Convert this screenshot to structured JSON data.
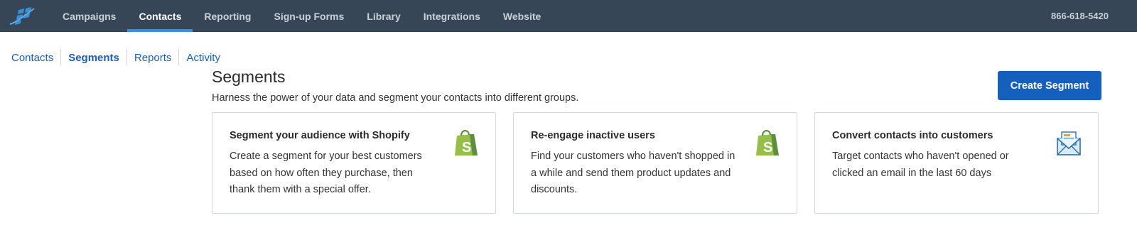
{
  "topnav": {
    "items": [
      {
        "label": "Campaigns",
        "active": false
      },
      {
        "label": "Contacts",
        "active": true
      },
      {
        "label": "Reporting",
        "active": false
      },
      {
        "label": "Sign-up Forms",
        "active": false
      },
      {
        "label": "Library",
        "active": false
      },
      {
        "label": "Integrations",
        "active": false
      },
      {
        "label": "Website",
        "active": false
      }
    ],
    "phone": "866-618-5420"
  },
  "subnav": {
    "items": [
      {
        "label": "Contacts",
        "active": false
      },
      {
        "label": "Segments",
        "active": true
      },
      {
        "label": "Reports",
        "active": false
      },
      {
        "label": "Activity",
        "active": false
      }
    ]
  },
  "page": {
    "title": "Segments",
    "subtitle": "Harness the power of your data and segment your contacts into different groups.",
    "create_button": "Create Segment"
  },
  "cards": [
    {
      "title": "Segment your audience with Shopify",
      "description": "Create a segment for your best customers based on how often they purchase, then thank them with a special offer.",
      "icon": "shopify-bag-icon"
    },
    {
      "title": "Re-engage inactive users",
      "description": "Find your customers who haven't shopped in a while and send them product updates and discounts.",
      "icon": "shopify-bag-icon"
    },
    {
      "title": "Convert contacts into customers",
      "description": "Target contacts who haven't opened or clicked an email in the last 60 days",
      "icon": "envelope-icon"
    }
  ],
  "colors": {
    "topnav_bg": "#364657",
    "accent": "#1560bd",
    "active_underline": "#3b8fd8",
    "shopify_green": "#95bf47"
  }
}
